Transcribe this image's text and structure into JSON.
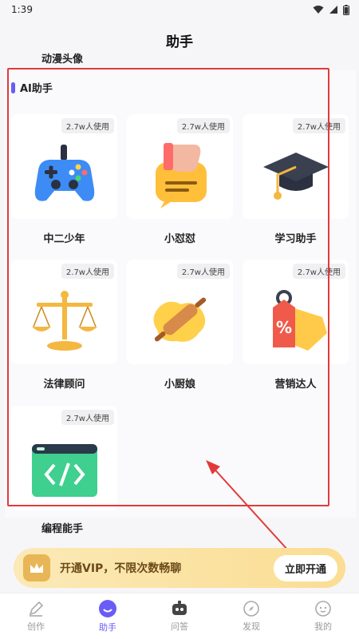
{
  "status": {
    "time": "1:39"
  },
  "page": {
    "title": "助手"
  },
  "categories": {
    "above": "动漫头像",
    "below": "编程能手"
  },
  "section": {
    "title": "AI助手"
  },
  "tiles": [
    {
      "label": "中二少年",
      "badge": "2.7w人使用",
      "icon": "gamepad-icon"
    },
    {
      "label": "小怼怼",
      "badge": "2.7w人使用",
      "icon": "thumbs-down-icon"
    },
    {
      "label": "学习助手",
      "badge": "2.7w人使用",
      "icon": "graduation-cap-icon"
    },
    {
      "label": "法律顾问",
      "badge": "2.7w人使用",
      "icon": "scales-icon"
    },
    {
      "label": "小厨娘",
      "badge": "2.7w人使用",
      "icon": "rolling-pin-icon"
    },
    {
      "label": "营销达人",
      "badge": "2.7w人使用",
      "icon": "price-tag-icon"
    },
    {
      "label": "",
      "badge": "2.7w人使用",
      "icon": "code-window-icon"
    }
  ],
  "vip": {
    "text": "开通VIP，不限次数畅聊",
    "button": "立即开通"
  },
  "nav": [
    {
      "label": "创作",
      "icon": "pencil-icon"
    },
    {
      "label": "助手",
      "icon": "smile-icon",
      "active": true
    },
    {
      "label": "问答",
      "icon": "robot-icon"
    },
    {
      "label": "发现",
      "icon": "compass-icon"
    },
    {
      "label": "我的",
      "icon": "face-icon"
    }
  ],
  "colors": {
    "accent": "#6a5cf6",
    "annotation": "#e23a3a",
    "vip_bg": "#fbe4a5"
  }
}
